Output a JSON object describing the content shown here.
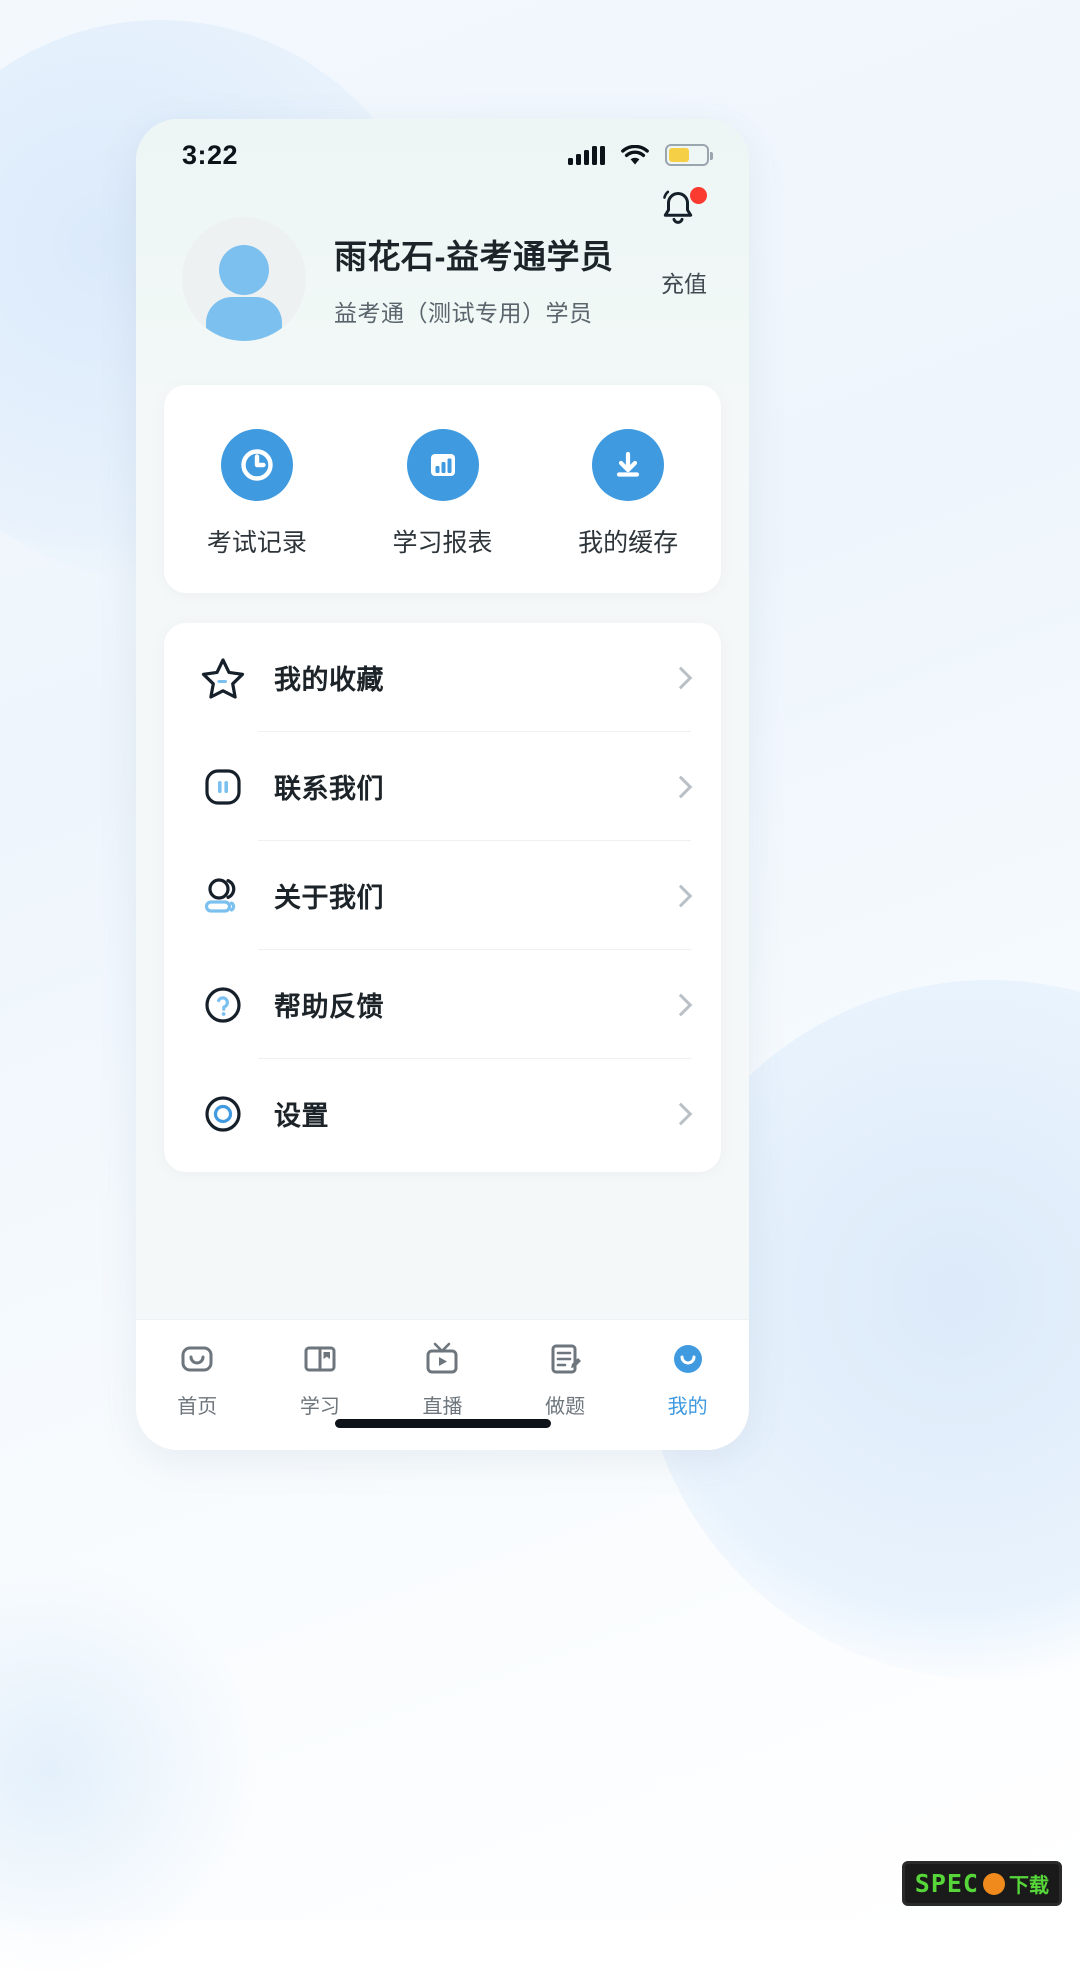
{
  "statusbar": {
    "time": "3:22",
    "signal_icon": "cellular-signal-icon",
    "wifi_icon": "wifi-icon",
    "battery_icon": "battery-icon",
    "battery_color": "#f5cf45",
    "battery_level_pct": 55
  },
  "header": {
    "notification_icon": "bell-icon",
    "has_unread_badge": true,
    "badge_color": "#fb3b30",
    "avatar_icon": "user-avatar",
    "name": "雨花石-益考通学员",
    "subtitle": "益考通（测试专用）学员",
    "recharge_label": "充值"
  },
  "quick_actions": {
    "accent_color": "#3f9ae0",
    "items": [
      {
        "label": "考试记录",
        "icon": "clock-icon"
      },
      {
        "label": "学习报表",
        "icon": "bar-chart-icon"
      },
      {
        "label": "我的缓存",
        "icon": "download-icon"
      }
    ]
  },
  "menu": {
    "items": [
      {
        "label": "我的收藏",
        "icon": "star-icon",
        "chevron": "chevron-right-icon"
      },
      {
        "label": "联系我们",
        "icon": "contact-icon",
        "chevron": "chevron-right-icon"
      },
      {
        "label": "关于我们",
        "icon": "about-icon",
        "chevron": "chevron-right-icon"
      },
      {
        "label": "帮助反馈",
        "icon": "question-circle-icon",
        "chevron": "chevron-right-icon"
      },
      {
        "label": "设置",
        "icon": "settings-icon",
        "chevron": "chevron-right-icon"
      }
    ]
  },
  "tabbar": {
    "active_color": "#3f9ae0",
    "inactive_color": "#6d767d",
    "items": [
      {
        "label": "首页",
        "icon": "home-icon",
        "active": false
      },
      {
        "label": "学习",
        "icon": "book-icon",
        "active": false
      },
      {
        "label": "直播",
        "icon": "tv-icon",
        "active": false
      },
      {
        "label": "做题",
        "icon": "note-pencil-icon",
        "active": false
      },
      {
        "label": "我的",
        "icon": "profile-icon",
        "active": true
      }
    ]
  },
  "watermark": {
    "text": "SPEC",
    "o_glyph": "O",
    "suffix": "下载"
  }
}
